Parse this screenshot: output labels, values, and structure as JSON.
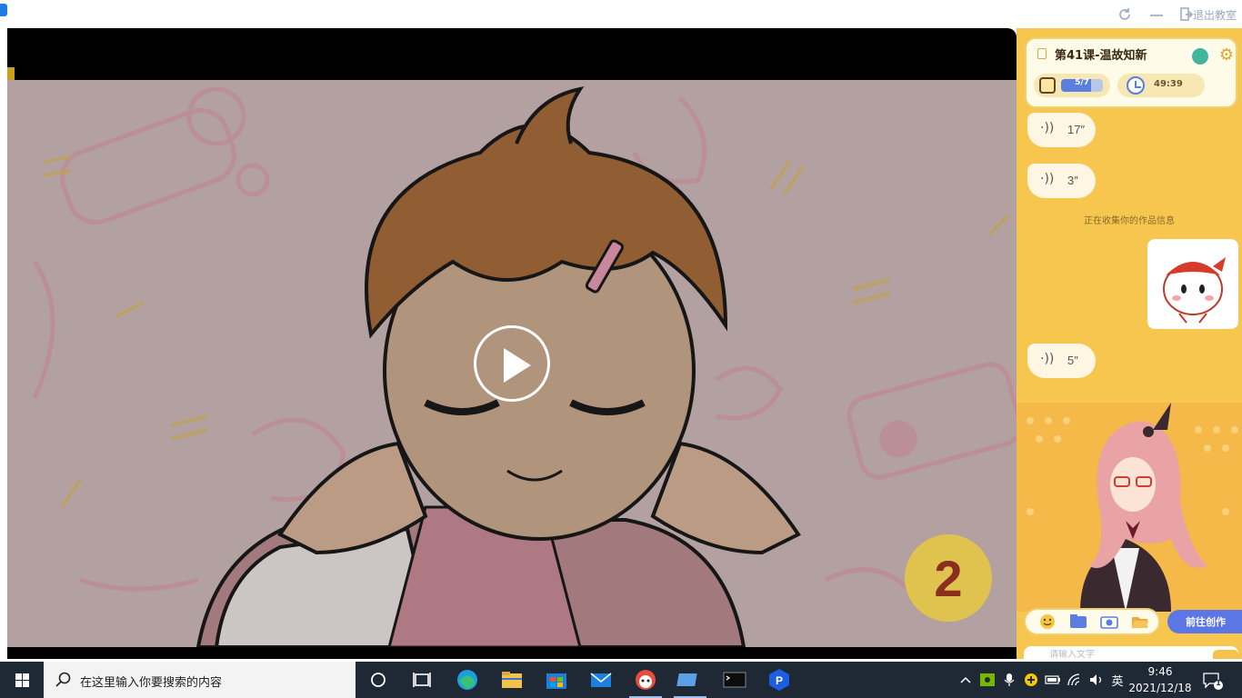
{
  "window": {
    "exit_label": "退出教室",
    "refresh_icon": "refresh-icon",
    "minimize_icon": "minimize-icon"
  },
  "video": {
    "countdown": "2",
    "play_icon": "play-icon"
  },
  "panel": {
    "lesson_title": "第41课-温故知新",
    "progress": {
      "text": "5/7",
      "current": 5,
      "total": 7
    },
    "timer": "49:39",
    "messages": [
      {
        "type": "voice",
        "duration": "17″"
      },
      {
        "type": "voice",
        "duration": "3″"
      },
      {
        "type": "system",
        "text": "正在收集你的作品信息"
      },
      {
        "type": "sticker"
      },
      {
        "type": "voice",
        "duration": "5″"
      }
    ],
    "goto_create_label": "前往创作",
    "input_placeholder": "请输入文字",
    "tools": [
      "emoji-icon",
      "folder-icon",
      "camera-icon",
      "open-folder-icon"
    ]
  },
  "taskbar": {
    "search_placeholder": "在这里输入你要搜索的内容",
    "ime": "英",
    "time": "9:46",
    "date": "2021/12/18",
    "notification_count": "1"
  },
  "colors": {
    "panel_bg": "#f6c64e",
    "accent_blue": "#5c76e6",
    "taskbar_bg": "#1f2935"
  }
}
